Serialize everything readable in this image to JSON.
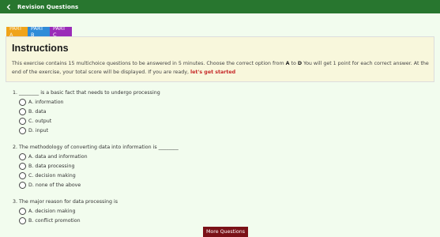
{
  "header": {
    "title": "Revision Questions",
    "back_icon": "chevron-left-icon"
  },
  "tabs": [
    {
      "label": "PART A"
    },
    {
      "label": "PART B"
    },
    {
      "label": "PART C"
    }
  ],
  "instructions": {
    "heading": "Instructions",
    "text_1": "This exercise contains 15 multichoice questions to be answered in 5 minutes. Choose the correct option from ",
    "bold_a": "A",
    "text_2": " to ",
    "bold_d": "D",
    "text_3": " You will get 1 point for each correct answer. At the end of the exercise, your total score will be displayed. If you are ready, ",
    "start_link": "let's get started"
  },
  "questions": [
    {
      "text": "1. ________ is a basic fact that needs to undergo processing",
      "options": [
        "A. information",
        "B. data",
        "C. output",
        "D. input"
      ]
    },
    {
      "text": "2. The methodology of converting data into information is ________",
      "options": [
        "A. data and information",
        "B. data processing",
        "C. decision making",
        "D. none of the above"
      ]
    },
    {
      "text": "3. The major reason for data processing is",
      "options": [
        "A. decision making",
        "B. conflict promotion"
      ]
    }
  ],
  "more_button": "More Questions",
  "colors": {
    "topbar": "#28762f",
    "background": "#f2fcee",
    "tab_a": "#f0a41a",
    "tab_b": "#2e8bd8",
    "tab_c": "#9a2bb8",
    "panel": "#f8f7dc",
    "start_link": "#c62828",
    "more_button": "#7a1117"
  }
}
